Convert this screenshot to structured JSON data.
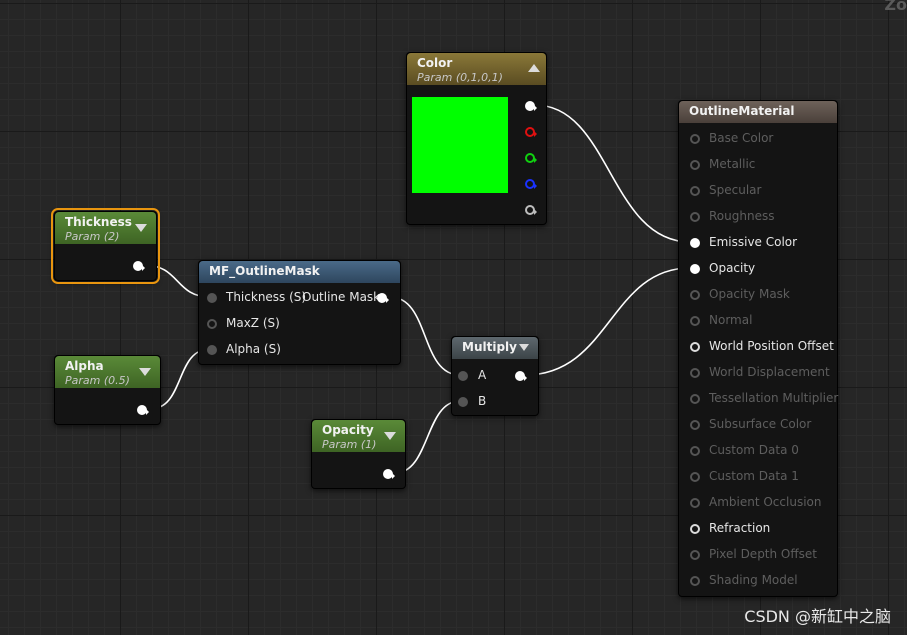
{
  "canvas": {
    "zoom_label": "Zo",
    "watermark": "CSDN @新缸中之脑"
  },
  "nodes": {
    "color": {
      "title": "Color",
      "subtitle": "Param (0,1,0,1)",
      "swatch_color": "#00ff00"
    },
    "thickness": {
      "title": "Thickness",
      "subtitle": "Param (2)"
    },
    "alpha": {
      "title": "Alpha",
      "subtitle": "Param (0.5)"
    },
    "outline_mask": {
      "title": "MF_OutlineMask",
      "inputs": [
        "Thickness (S)",
        "MaxZ (S)",
        "Alpha (S)"
      ],
      "output": "Outline Mask"
    },
    "multiply": {
      "title": "Multiply",
      "inputs": [
        "A",
        "B"
      ]
    },
    "opacity": {
      "title": "Opacity",
      "subtitle": "Param (1)"
    },
    "material": {
      "title": "OutlineMaterial",
      "pins": [
        {
          "label": "Base Color",
          "active": false
        },
        {
          "label": "Metallic",
          "active": false
        },
        {
          "label": "Specular",
          "active": false
        },
        {
          "label": "Roughness",
          "active": false
        },
        {
          "label": "Emissive Color",
          "active": true
        },
        {
          "label": "Opacity",
          "active": true
        },
        {
          "label": "Opacity Mask",
          "active": false
        },
        {
          "label": "Normal",
          "active": false
        },
        {
          "label": "World Position Offset",
          "active": true
        },
        {
          "label": "World Displacement",
          "active": false
        },
        {
          "label": "Tessellation Multiplier",
          "active": false
        },
        {
          "label": "Subsurface Color",
          "active": false
        },
        {
          "label": "Custom Data 0",
          "active": false
        },
        {
          "label": "Custom Data 1",
          "active": false
        },
        {
          "label": "Ambient Occlusion",
          "active": false
        },
        {
          "label": "Refraction",
          "active": true
        },
        {
          "label": "Pixel Depth Offset",
          "active": false
        },
        {
          "label": "Shading Model",
          "active": false
        }
      ]
    }
  },
  "colors": {
    "param_header": "#4c7a2c",
    "vector_param_header": "#7a6a30",
    "function_header": "#3a5670",
    "material_header": "#5a4e48",
    "selection": "#e8950f",
    "wire": "#ffffff"
  }
}
